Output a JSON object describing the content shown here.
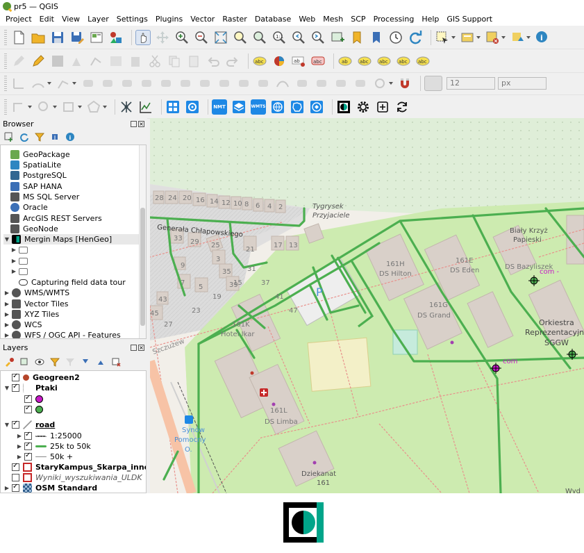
{
  "window": {
    "title": "pr5 — QGIS"
  },
  "menu": [
    "Project",
    "Edit",
    "View",
    "Layer",
    "Settings",
    "Plugins",
    "Vector",
    "Raster",
    "Database",
    "Web",
    "Mesh",
    "SCP",
    "Processing",
    "Help",
    "GIS Support"
  ],
  "toolbar4_labels": {
    "nmt": "NMT",
    "wmts": "WMTS"
  },
  "toolbar3": {
    "size_value": "12",
    "unit_value": "px"
  },
  "browser": {
    "title": "Browser",
    "items": [
      {
        "label": "GeoPackage",
        "icon": "geopackage-icon"
      },
      {
        "label": "SpatiaLite",
        "icon": "spatialite-icon"
      },
      {
        "label": "PostgreSQL",
        "icon": "postgresql-icon"
      },
      {
        "label": "SAP HANA",
        "icon": "sap-hana-icon"
      },
      {
        "label": "MS SQL Server",
        "icon": "mssql-icon"
      },
      {
        "label": "Oracle",
        "icon": "oracle-icon"
      },
      {
        "label": "ArcGIS REST Servers",
        "icon": "arcgis-icon"
      },
      {
        "label": "GeoNode",
        "icon": "geonode-icon"
      },
      {
        "label": "Mergin Maps [HenGeo]",
        "icon": "mergin-maps-icon"
      },
      {
        "label": "Capturing field data tour",
        "icon": "cloud-icon"
      },
      {
        "label": "WMS/WMTS",
        "icon": "globe-icon"
      },
      {
        "label": "Vector Tiles",
        "icon": "vector-tiles-icon"
      },
      {
        "label": "XYZ Tiles",
        "icon": "xyz-tiles-icon"
      },
      {
        "label": "WCS",
        "icon": "globe-icon"
      },
      {
        "label": "WFS / OGC API - Features",
        "icon": "globe-icon"
      }
    ]
  },
  "layers": {
    "title": "Layers",
    "items": [
      {
        "label": "Geogreen2",
        "checked": true
      },
      {
        "label": "Ptaki",
        "checked": true
      },
      {
        "label": "road",
        "checked": true
      },
      {
        "label": "1:25000",
        "checked": true
      },
      {
        "label": "25k to 50k",
        "checked": true
      },
      {
        "label": "50k +",
        "checked": true
      },
      {
        "label": "StaryKampus_Skarpa_inne",
        "checked": true
      },
      {
        "label": "Wyniki_wyszukiwania_ULDK",
        "checked": false
      },
      {
        "label": "OSM Standard",
        "checked": true
      }
    ]
  },
  "map": {
    "labels": {
      "street": "Generała Chłapowskiego",
      "tygrysek": "Tygrysek",
      "przyjaciele": "Przyjaciele",
      "bialy": "Biały Krzyż",
      "papieski": "Papieski",
      "h161": "161H",
      "dshilton": "DS Hilton",
      "e161": "161E",
      "dseden": "DS Eden",
      "dsbazy": "DS Bazyliszek",
      "com1": "com -",
      "g161": "161G",
      "dsgrand": "DS Grand",
      "orkiestra": "Orkiestra",
      "reprez": "Reprezentacyjna",
      "sggw": "SGGW",
      "k161": "161K",
      "hotel": "Hotel Ikar",
      "p": "P",
      "l161": "161L",
      "dslimba": "DS Limba",
      "com2": "com",
      "dziekanat": "Dziekanat",
      "n161": "161",
      "synow": "Synów",
      "pomocny": "Pomocny",
      "o": "O.",
      "szczuzew": "Szczużew",
      "wyd": "Wyd"
    },
    "house_numbers": [
      "28",
      "24",
      "20",
      "16",
      "14",
      "12",
      "10",
      "8",
      "6",
      "4",
      "2",
      "33",
      "29",
      "25",
      "21",
      "17",
      "13",
      "9",
      "7",
      "5",
      "3",
      "35",
      "39",
      "43",
      "45",
      "15",
      "19",
      "23",
      "27",
      "31",
      "37",
      "41",
      "47"
    ],
    "colors": {
      "background": "#f2efe9",
      "park": "#cdebb0",
      "building": "#d9d0c9",
      "road": "#4caf50",
      "path": "#e8908b"
    }
  },
  "bottom_logo": {
    "icon": "mergin-maps-logo"
  }
}
